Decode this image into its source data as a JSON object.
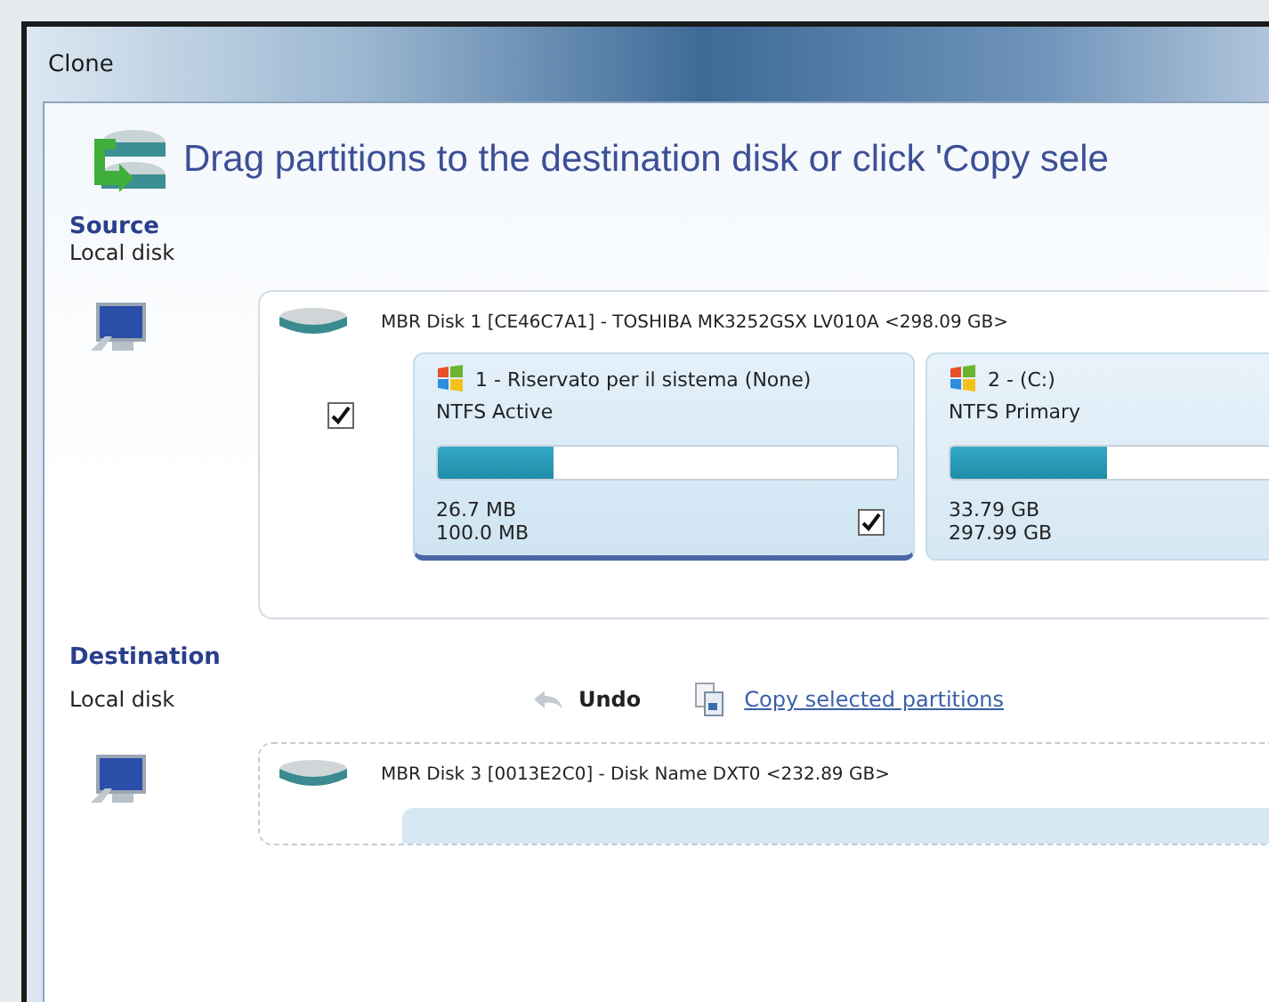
{
  "window": {
    "title": "Clone"
  },
  "instruction": "Drag partitions to the destination disk or click 'Copy sele",
  "source": {
    "heading": "Source",
    "label": "Local disk",
    "disk": {
      "title": "MBR Disk 1 [CE46C7A1] - TOSHIBA MK3252GSX LV010A  <298.09 GB>",
      "checked": true,
      "partitions": [
        {
          "name": "1 - Riservato per il sistema (None)",
          "type": "NTFS Active",
          "level": 0.25,
          "used": "26.7 MB",
          "size": "100.0 MB",
          "checked": true,
          "selected": true
        },
        {
          "name": "2 -  (C:)",
          "type": "NTFS Primary",
          "level": 0.34,
          "used": "33.79 GB",
          "size": "297.99 GB",
          "selected": false
        }
      ]
    }
  },
  "destination": {
    "heading": "Destination",
    "label": "Local disk",
    "undo": {
      "label": "Undo",
      "disabled": true
    },
    "copy_link": "Copy selected partitions",
    "disk": {
      "title": "MBR Disk 3 [0013E2C0] - Disk     Name DXT0  <232.89 GB>"
    }
  }
}
